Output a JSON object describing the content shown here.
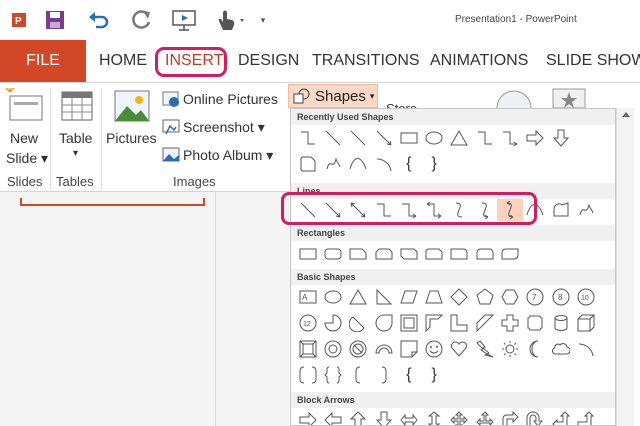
{
  "window": {
    "title": "Presentation1 - PowerPoint"
  },
  "tabs": {
    "file": "FILE",
    "home": "HOME",
    "insert": "INSERT",
    "design": "DESIGN",
    "transitions": "TRANSITIONS",
    "animations": "ANIMATIONS",
    "slide_show": "SLIDE SHOW"
  },
  "ribbon": {
    "new_slide_1": "New",
    "new_slide_2": "Slide ▾",
    "table_1": "Table",
    "table_2": "▾",
    "pictures": "Pictures",
    "online_pictures": "Online Pictures",
    "screenshot": "Screenshot ▾",
    "photo_album": "Photo Album ▾",
    "shapes": "Shapes",
    "store": "Store",
    "groups": {
      "slides": "Slides",
      "tables": "Tables",
      "images": "Images"
    }
  },
  "gallery": {
    "recent_header": "Recently Used Shapes",
    "lines_header": "Lines",
    "rectangles_header": "Rectangles",
    "basic_header": "Basic Shapes",
    "block_arrows_header": "Block Arrows",
    "brace_left": "{",
    "brace_right": "}",
    "textbox_glyph": "A≡"
  },
  "colors": {
    "accent": "#d24726",
    "highlight": "#d81b60",
    "shape_hover": "#fcd2bd"
  }
}
